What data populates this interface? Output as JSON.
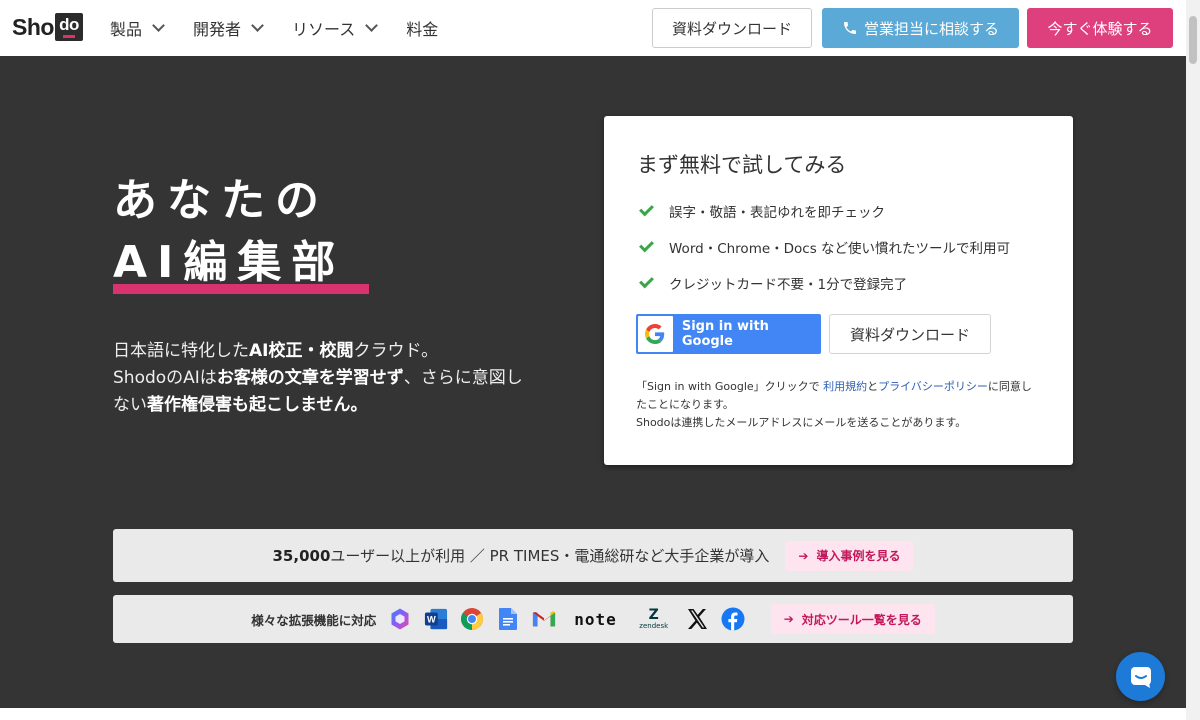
{
  "header": {
    "logo_prefix": "Sho",
    "logo_box": "do",
    "nav": [
      "製品",
      "開発者",
      "リソース",
      "料金"
    ],
    "download_button": "資料ダウンロード",
    "sales_button": "営業担当に相談する",
    "try_button": "今すぐ体験する"
  },
  "hero": {
    "headline_line1": "あなたの",
    "headline_line2": "AI編集部",
    "desc": {
      "p1": "日本語に特化した",
      "p1_bold": "AI校正・校閲",
      "p1_end": "クラウド。",
      "p2": "ShodoのAIは",
      "p2_bold": "お客様の文章を学習せず",
      "p2_end": "、さらに意図しない",
      "p3_bold": "著作権侵害も起こしません。"
    }
  },
  "signup": {
    "title": "まず無料で試してみる",
    "checks": [
      "誤字・敬語・表記ゆれを即チェック",
      "Word・Chrome・Docs など使い慣れたツールで利用可",
      "クレジットカード不要・1分で登録完了"
    ],
    "google_button": "Sign in with Google",
    "download_button": "資料ダウンロード",
    "terms": {
      "t1": "「Sign in with Google」クリックで ",
      "link_terms": "利用規約",
      "t2": "と",
      "link_privacy": "プライバシーポリシー",
      "t3": "に同意したことになります。",
      "t4": "Shodoは連携したメールアドレスにメールを送ることがあります。"
    }
  },
  "stats": {
    "users_bold": "35,000",
    "users_text": "ユーザー以上が利用 ／ PR TIMES・電通総研など大手企業が導入",
    "case_link": "導入事例を見る"
  },
  "integrations": {
    "label": "様々な拡張機能に対応",
    "icons": [
      "copilot-icon",
      "word-icon",
      "chrome-icon",
      "google-docs-icon",
      "gmail-icon",
      "note-logo",
      "zendesk-logo",
      "x-icon",
      "facebook-icon"
    ],
    "note_text": "note",
    "zendesk_text": "zendesk",
    "tools_link": "対応ツール一覧を見る"
  },
  "colors": {
    "hero_bg": "#353434",
    "accent_pink": "#de3f7d",
    "sales_blue": "#5aa9d6",
    "google_blue": "#4285f4",
    "check_green": "#3aa64a",
    "pill_bg": "#fde4ee",
    "chat_blue": "#1d7ad6"
  }
}
